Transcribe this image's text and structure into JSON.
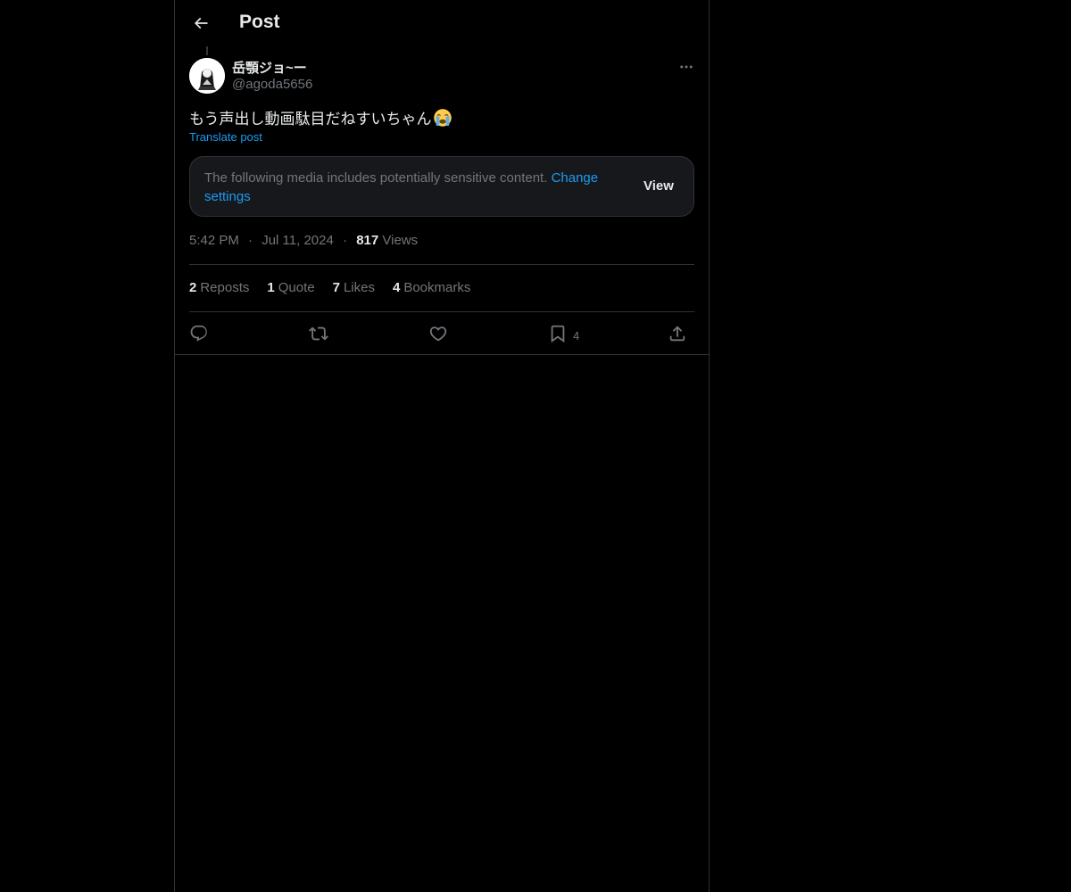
{
  "header": {
    "title": "Post"
  },
  "post": {
    "display_name": "岳顎ジョ~ー",
    "handle": "@agoda5656",
    "text": "もう声出し動画駄目だねすいちゃん",
    "emoji": "loudly-crying-face",
    "translate_label": "Translate post",
    "sensitive": {
      "message": "The following media includes potentially sensitive content.",
      "change_settings_label": "Change settings",
      "view_label": "View"
    },
    "time": "5:42 PM",
    "date": "Jul 11, 2024",
    "views_count": "817",
    "views_label": "Views",
    "separator": "·"
  },
  "stats": {
    "reposts_count": "2",
    "reposts_label": "Reposts",
    "quotes_count": "1",
    "quotes_label": "Quote",
    "likes_count": "7",
    "likes_label": "Likes",
    "bookmarks_count": "4",
    "bookmarks_label": "Bookmarks"
  },
  "actions": {
    "reply_icon": "reply-icon",
    "repost_icon": "repost-icon",
    "like_icon": "heart-icon",
    "bookmark_icon": "bookmark-icon",
    "bookmark_count": "4",
    "share_icon": "share-icon"
  },
  "colors": {
    "background": "#000000",
    "text_primary": "#e7e9ea",
    "text_secondary": "#71767b",
    "accent": "#1d9bf0",
    "border": "#2f3336",
    "card_bg": "#16181c"
  }
}
